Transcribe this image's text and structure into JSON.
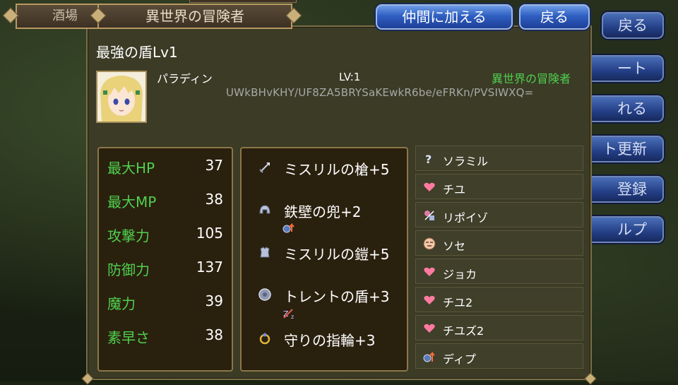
{
  "tabs": {
    "back_label": "酒場",
    "front_label": "異世界の冒険者"
  },
  "buttons": {
    "join": "仲間に加える",
    "back": "戻る"
  },
  "side_buttons": [
    "戻る",
    "ート",
    "れる",
    "ト更新",
    "登録",
    "ルプ"
  ],
  "character": {
    "name": "最強の盾Lv1",
    "class": "パラディン",
    "level": "LV:1",
    "origin": "異世界の冒険者",
    "code": "UWkBHvKHY/UF8ZA5BRYSaKEwkR6be/eFRKn/PVSIWXQ="
  },
  "stats": [
    {
      "label": "最大HP",
      "value": "37"
    },
    {
      "label": "最大MP",
      "value": "38"
    },
    {
      "label": "攻撃力",
      "value": "105"
    },
    {
      "label": "防御力",
      "value": "137"
    },
    {
      "label": "魔力",
      "value": "39"
    },
    {
      "label": "素早さ",
      "value": "38"
    }
  ],
  "equipment": [
    {
      "label": "ミスリルの槍+5",
      "icon": "spear-icon"
    },
    {
      "label": "鉄壁の兜+2",
      "icon": "helmet-icon"
    },
    {
      "label": "ミスリルの鎧+5",
      "icon": "armor-icon"
    },
    {
      "label": "トレントの盾+3",
      "icon": "shield-icon"
    },
    {
      "label": "守りの指輪+3",
      "icon": "ring-icon"
    }
  ],
  "skills": [
    {
      "label": "ソラミル",
      "icon": "question-icon"
    },
    {
      "label": "チユ",
      "icon": "heart-icon"
    },
    {
      "label": "リポイゾ",
      "icon": "antidote-icon"
    },
    {
      "label": "ソセ",
      "icon": "face-icon"
    },
    {
      "label": "ジョカ",
      "icon": "heart-icon"
    },
    {
      "label": "チユ2",
      "icon": "heart-icon"
    },
    {
      "label": "チユズ2",
      "icon": "heart-icon"
    },
    {
      "label": "ディプ",
      "icon": "defense-up-icon"
    }
  ],
  "colors": {
    "stat_label": "#4fd14f",
    "origin_text": "#4fd14f",
    "button_blue": "#2f5fc2",
    "panel_bg": "#3b3b26",
    "subpanel_bg": "#2a200e",
    "frame_gold": "#b89a62"
  }
}
